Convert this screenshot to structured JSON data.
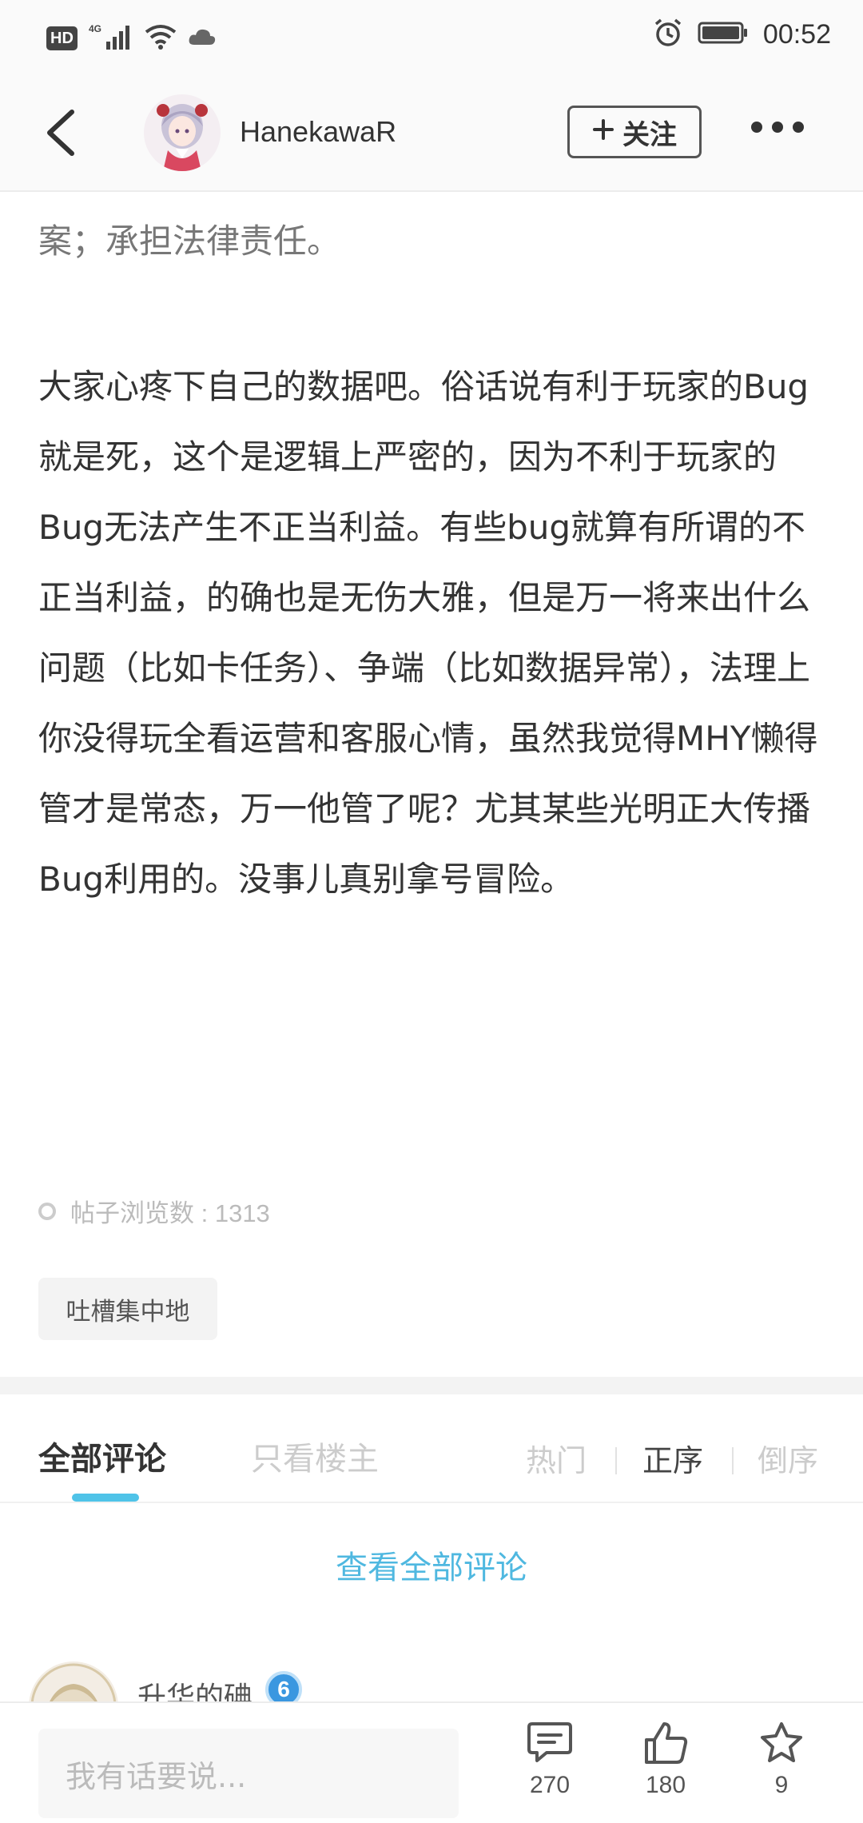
{
  "status_bar": {
    "hd": "HD",
    "network": "4G",
    "time": "00:52"
  },
  "header": {
    "username": "HanekawaR",
    "follow_label": "关注"
  },
  "article": {
    "partial_line": "案；承担法律责任。",
    "paragraph": "大家心疼下自己的数据吧。俗话说有利于玩家的Bug就是死，这个是逻辑上严密的，因为不利于玩家的Bug无法产生不正当利益。有些bug就算有所谓的不正当利益，的确也是无伤大雅，但是万一将来出什么问题（比如卡任务）、争端（比如数据异常），法理上你没得玩全看运营和客服心情，虽然我觉得MHY懒得管才是常态，万一他管了呢？尤其某些光明正大传播Bug利用的。没事儿真别拿号冒险。"
  },
  "meta": {
    "views": "帖子浏览数 : 1313",
    "tag": "吐槽集中地"
  },
  "comments": {
    "tab_all": "全部评论",
    "tab_op_only": "只看楼主",
    "sort_hot": "热门",
    "sort_asc": "正序",
    "sort_desc": "倒序",
    "view_all": "查看全部评论",
    "first_commenter": "升华的碘",
    "first_commenter_level": "6"
  },
  "bottom_bar": {
    "input_placeholder": "我有话要说...",
    "comment_count": "270",
    "like_count": "180",
    "favorite_count": "9"
  },
  "colors": {
    "accent": "#4fc3e8",
    "link": "#4fb8e0"
  }
}
